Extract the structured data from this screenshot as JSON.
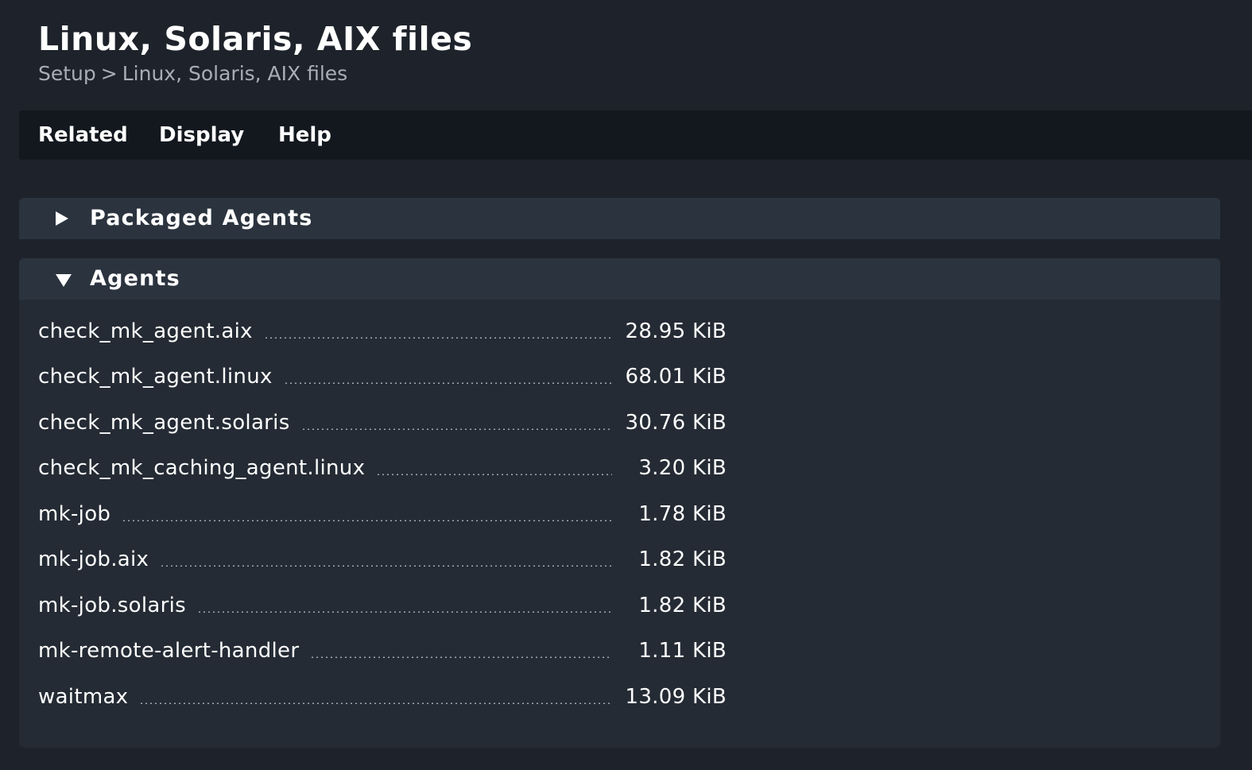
{
  "page": {
    "title": "Linux, Solaris, AIX files"
  },
  "breadcrumb": {
    "items": [
      "Setup",
      "Linux, Solaris, AIX files"
    ],
    "separator": ">"
  },
  "menubar": {
    "items": [
      "Related",
      "Display",
      "Help"
    ]
  },
  "sections": {
    "packaged": {
      "title": "Packaged Agents",
      "state": "collapsed"
    },
    "agents": {
      "title": "Agents",
      "state": "expanded",
      "files": [
        {
          "name": "check_mk_agent.aix",
          "size": "28.95 KiB"
        },
        {
          "name": "check_mk_agent.linux",
          "size": "68.01 KiB"
        },
        {
          "name": "check_mk_agent.solaris",
          "size": "30.76 KiB"
        },
        {
          "name": "check_mk_caching_agent.linux",
          "size": "3.20 KiB"
        },
        {
          "name": "mk-job",
          "size": "1.78 KiB"
        },
        {
          "name": "mk-job.aix",
          "size": "1.82 KiB"
        },
        {
          "name": "mk-job.solaris",
          "size": "1.82 KiB"
        },
        {
          "name": "mk-remote-alert-handler",
          "size": "1.11 KiB"
        },
        {
          "name": "waitmax",
          "size": "13.09 KiB"
        }
      ]
    }
  },
  "colors": {
    "background": "#1e232b",
    "menubar": "#13181f",
    "section_header": "#2b333e",
    "section_body": "#242b34",
    "breadcrumb_text": "#a7aeb7"
  },
  "icons": {
    "collapsed": "triangle-right-icon",
    "expanded": "triangle-down-icon"
  }
}
